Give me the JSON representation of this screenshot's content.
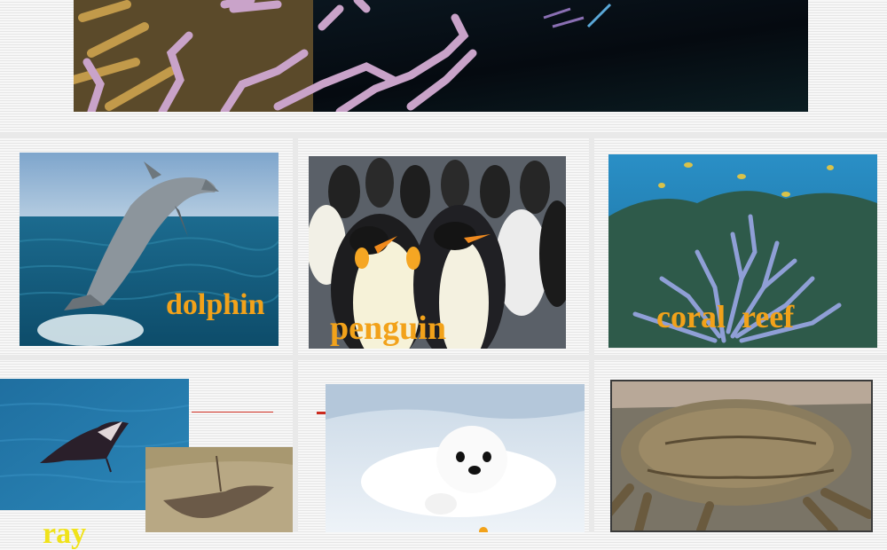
{
  "slide": {
    "banner": {
      "name": "coral-reef-banner"
    },
    "tiles": [
      {
        "key": "dolphin",
        "caption": "dolphin"
      },
      {
        "key": "penguin",
        "caption": "penguin"
      },
      {
        "key": "coral_reef",
        "caption": "coral  reef"
      },
      {
        "key": "ray",
        "caption": "ray"
      },
      {
        "key": "seal",
        "caption": ""
      },
      {
        "key": "crab",
        "caption": ""
      }
    ]
  },
  "colors": {
    "caption": "#f2a21a",
    "ray_caption": "#f0e21a",
    "accent_line": "#cc2b1f"
  }
}
